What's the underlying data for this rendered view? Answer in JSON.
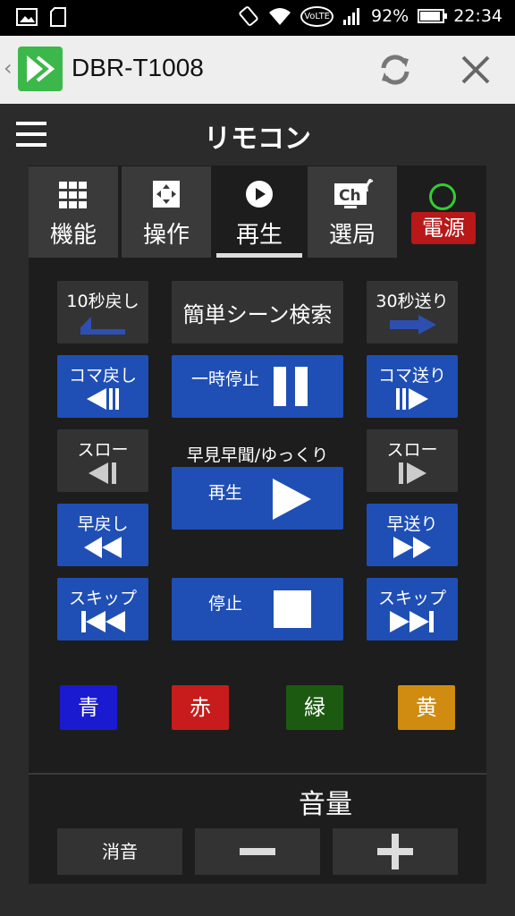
{
  "status_bar": {
    "battery": "92%",
    "time": "22:34",
    "network": "VoLTE"
  },
  "app_bar": {
    "title": "DBR-T1008"
  },
  "header": {
    "title": "リモコン"
  },
  "tabs": [
    {
      "label": "機能",
      "icon": "grid-icon"
    },
    {
      "label": "操作",
      "icon": "dpad-icon"
    },
    {
      "label": "再生",
      "icon": "play-circle-icon",
      "active": true
    },
    {
      "label": "選局",
      "icon": "channel-tv-icon"
    }
  ],
  "power": {
    "label": "電源"
  },
  "playback": {
    "skip_back_10": "10秒戻し",
    "scene_search": "簡単シーン検索",
    "skip_fwd_30": "30秒送り",
    "frame_back": "コマ戻し",
    "pause": "一時停止",
    "frame_fwd": "コマ送り",
    "slow_back": "スロー",
    "fast_watch": "早見早聞/ゆっくり",
    "slow_fwd": "スロー",
    "play": "再生",
    "rewind": "早戻し",
    "fast_forward": "早送り",
    "skip_prev": "スキップ",
    "stop": "停止",
    "skip_next": "スキップ"
  },
  "color_buttons": [
    {
      "label": "青",
      "color": "#1a1ad0"
    },
    {
      "label": "赤",
      "color": "#c81c1c"
    },
    {
      "label": "緑",
      "color": "#1c5a12"
    },
    {
      "label": "黄",
      "color": "#d08c10"
    }
  ],
  "volume": {
    "title": "音量",
    "mute": "消音",
    "down": "−",
    "up": "+"
  },
  "colors": {
    "accent_blue": "#1f4fb5",
    "power_red": "#b81818",
    "power_green": "#33cc33",
    "app_green": "#3cb84a"
  }
}
